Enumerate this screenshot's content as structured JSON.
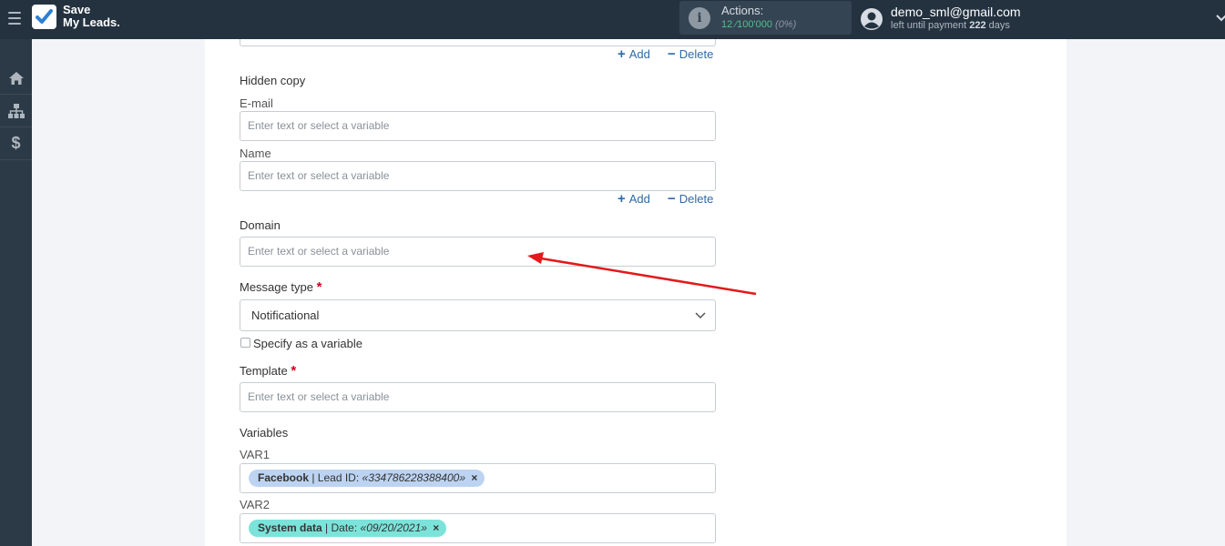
{
  "header": {
    "logo_line1": "Save",
    "logo_line2": "My Leads.",
    "actions_label": "Actions:",
    "actions_used": "12",
    "actions_total": "⁄100'000",
    "actions_percent": "(0%)",
    "user_email": "demo_sml@gmail.com",
    "payment_prefix": "left until payment",
    "payment_days": "222",
    "payment_suffix": "days"
  },
  "sidebar": {
    "items": [
      {
        "icon": "home-icon"
      },
      {
        "icon": "sitemap-icon"
      },
      {
        "icon": "dollar-icon"
      }
    ]
  },
  "form": {
    "add_label": "Add",
    "delete_label": "Delete",
    "hidden_copy": {
      "title": "Hidden copy",
      "email_label": "E-mail",
      "email_placeholder": "Enter text or select a variable",
      "name_label": "Name",
      "name_placeholder": "Enter text or select a variable"
    },
    "domain": {
      "label": "Domain",
      "placeholder": "Enter text or select a variable"
    },
    "message_type": {
      "label": "Message type",
      "required_mark": "*",
      "value": "Notificational"
    },
    "specify_variable": "Specify as a variable",
    "template": {
      "label": "Template",
      "required_mark": "*",
      "placeholder": "Enter text or select a variable"
    },
    "variables": {
      "title": "Variables",
      "items": [
        {
          "label": "VAR1",
          "chip_source": "Facebook",
          "chip_field": "| Lead ID:",
          "chip_value": "«334786228388400»",
          "remove": "×"
        },
        {
          "label": "VAR2",
          "chip_source": "System data",
          "chip_field": "| Date:",
          "chip_value": "«09/20/2021»",
          "remove": "×"
        }
      ]
    }
  },
  "colors": {
    "topbar": "#243240",
    "sidebar": "#2c3a47",
    "link": "#2d6aa8",
    "required": "#d0021b",
    "arrow": "#e3191b",
    "chip_blue": "#bdd3f2",
    "chip_teal": "#7ce3da"
  }
}
